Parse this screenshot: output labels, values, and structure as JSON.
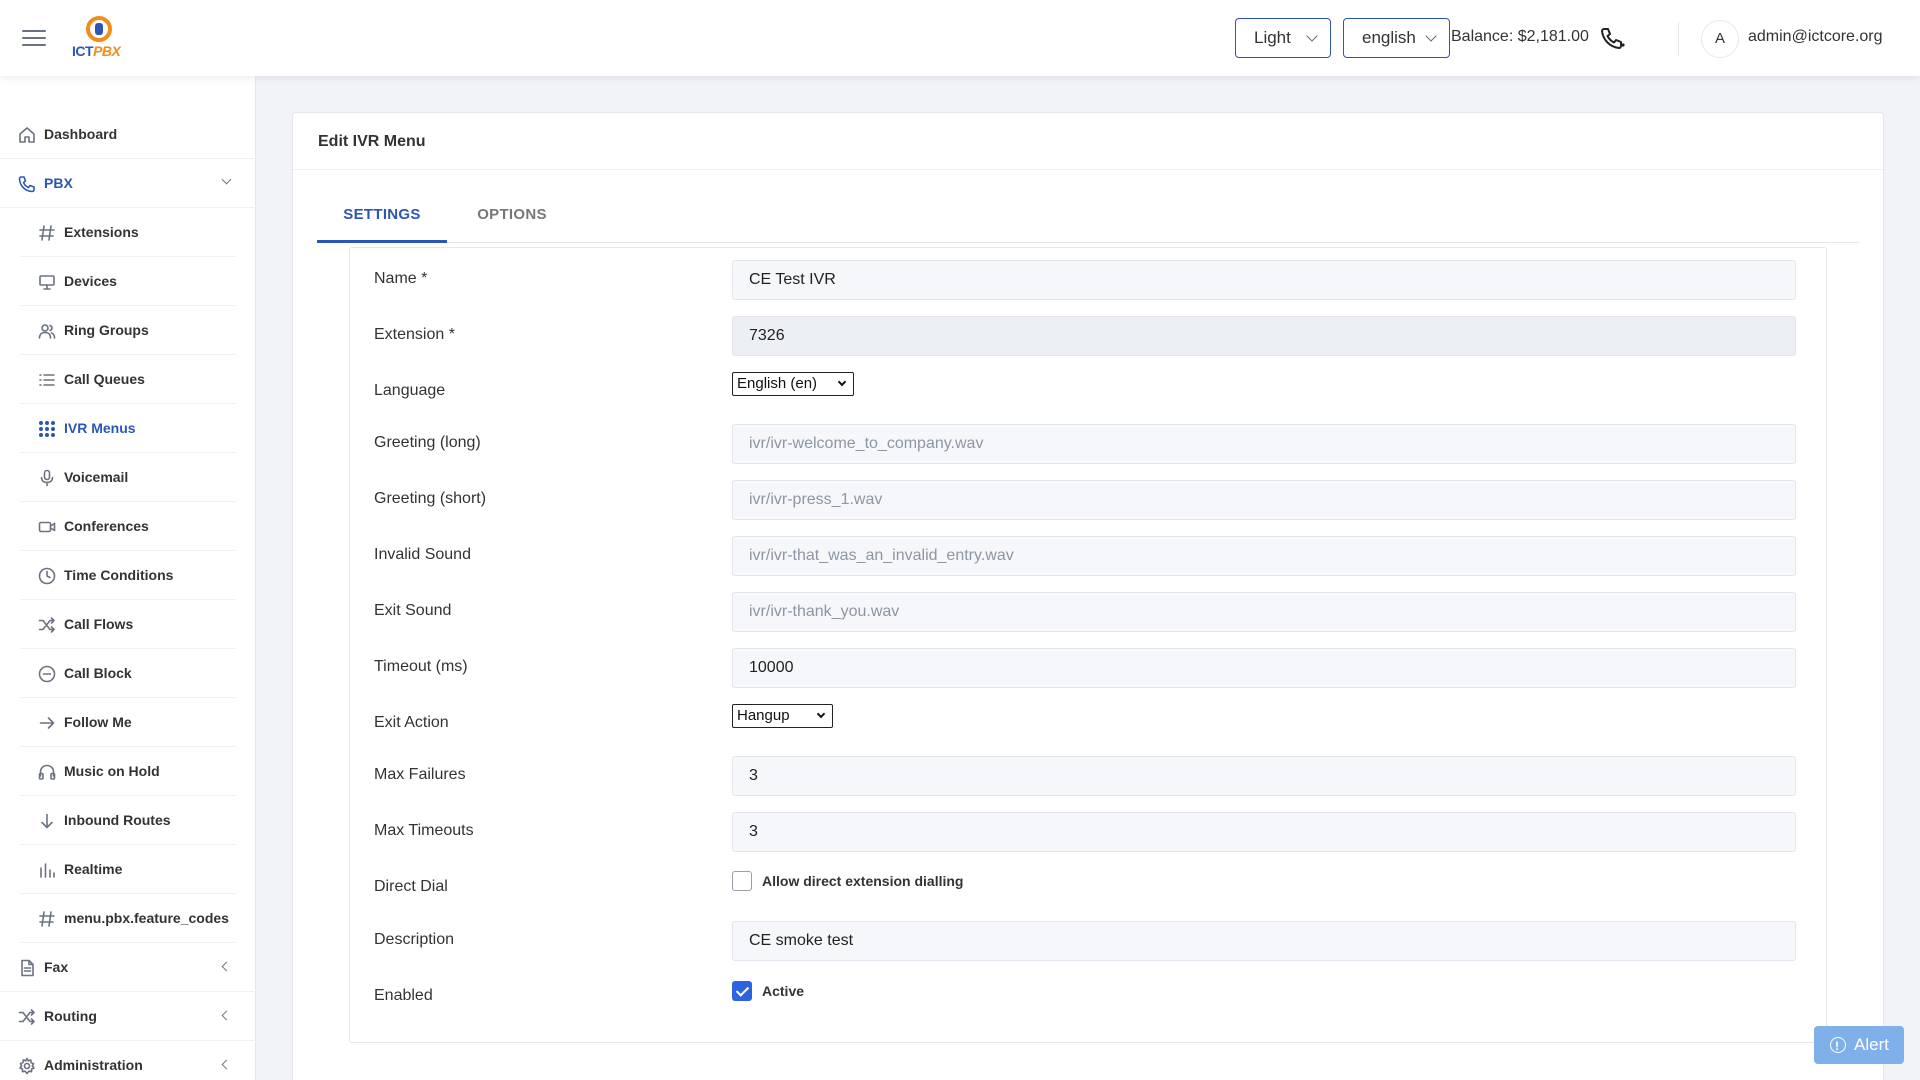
{
  "header": {
    "theme": "Light",
    "language": "english",
    "balance": "Balance: $2,181.00",
    "avatar_initial": "A",
    "user_email": "admin@ictcore.org",
    "logo_text_a": "ICT",
    "logo_text_b": "PBX"
  },
  "sidebar": {
    "dashboard": "Dashboard",
    "pbx": "PBX",
    "pbx_items": [
      {
        "label": "Extensions",
        "icon": "hash-icon"
      },
      {
        "label": "Devices",
        "icon": "monitor-icon"
      },
      {
        "label": "Ring Groups",
        "icon": "users-icon"
      },
      {
        "label": "Call Queues",
        "icon": "list-icon"
      },
      {
        "label": "IVR Menus",
        "icon": "grid-icon"
      },
      {
        "label": "Voicemail",
        "icon": "microphone-icon"
      },
      {
        "label": "Conferences",
        "icon": "video-icon"
      },
      {
        "label": "Time Conditions",
        "icon": "clock-icon"
      },
      {
        "label": "Call Flows",
        "icon": "shuffle-icon"
      },
      {
        "label": "Call Block",
        "icon": "minus-circle-icon"
      },
      {
        "label": "Follow Me",
        "icon": "arrow-right-icon"
      },
      {
        "label": "Music on Hold",
        "icon": "headphones-icon"
      },
      {
        "label": "Inbound Routes",
        "icon": "arrow-down-icon"
      },
      {
        "label": "Realtime",
        "icon": "bar-chart-icon"
      },
      {
        "label": "menu.pbx.feature_codes",
        "icon": "hash-icon"
      }
    ],
    "fax": "Fax",
    "routing": "Routing",
    "administration": "Administration"
  },
  "page": {
    "title": "Edit IVR Menu",
    "tabs": [
      "SETTINGS",
      "OPTIONS"
    ],
    "active_tab": "SETTINGS"
  },
  "form": {
    "name_label": "Name *",
    "name_value": "CE Test IVR",
    "extension_label": "Extension *",
    "extension_value": "7326",
    "language_label": "Language",
    "language_value": "English (en)",
    "greeting_long_label": "Greeting (long)",
    "greeting_long_placeholder": "ivr/ivr-welcome_to_company.wav",
    "greeting_short_label": "Greeting (short)",
    "greeting_short_placeholder": "ivr/ivr-press_1.wav",
    "invalid_sound_label": "Invalid Sound",
    "invalid_sound_placeholder": "ivr/ivr-that_was_an_invalid_entry.wav",
    "exit_sound_label": "Exit Sound",
    "exit_sound_placeholder": "ivr/ivr-thank_you.wav",
    "timeout_label": "Timeout (ms)",
    "timeout_value": "10000",
    "exit_action_label": "Exit Action",
    "exit_action_value": "Hangup",
    "max_failures_label": "Max Failures",
    "max_failures_value": "3",
    "max_timeouts_label": "Max Timeouts",
    "max_timeouts_value": "3",
    "direct_dial_label": "Direct Dial",
    "direct_dial_checkbox_label": "Allow direct extension dialling",
    "direct_dial_checked": false,
    "description_label": "Description",
    "description_value": "CE smoke test",
    "enabled_label": "Enabled",
    "enabled_checkbox_label": "Active",
    "enabled_checked": true
  },
  "alert_button": "Alert",
  "colors": {
    "accent": "#2b56b6",
    "checkbox": "#2b63e0",
    "logo_orange": "#f28c1a",
    "alert": "#7fb0ea"
  }
}
